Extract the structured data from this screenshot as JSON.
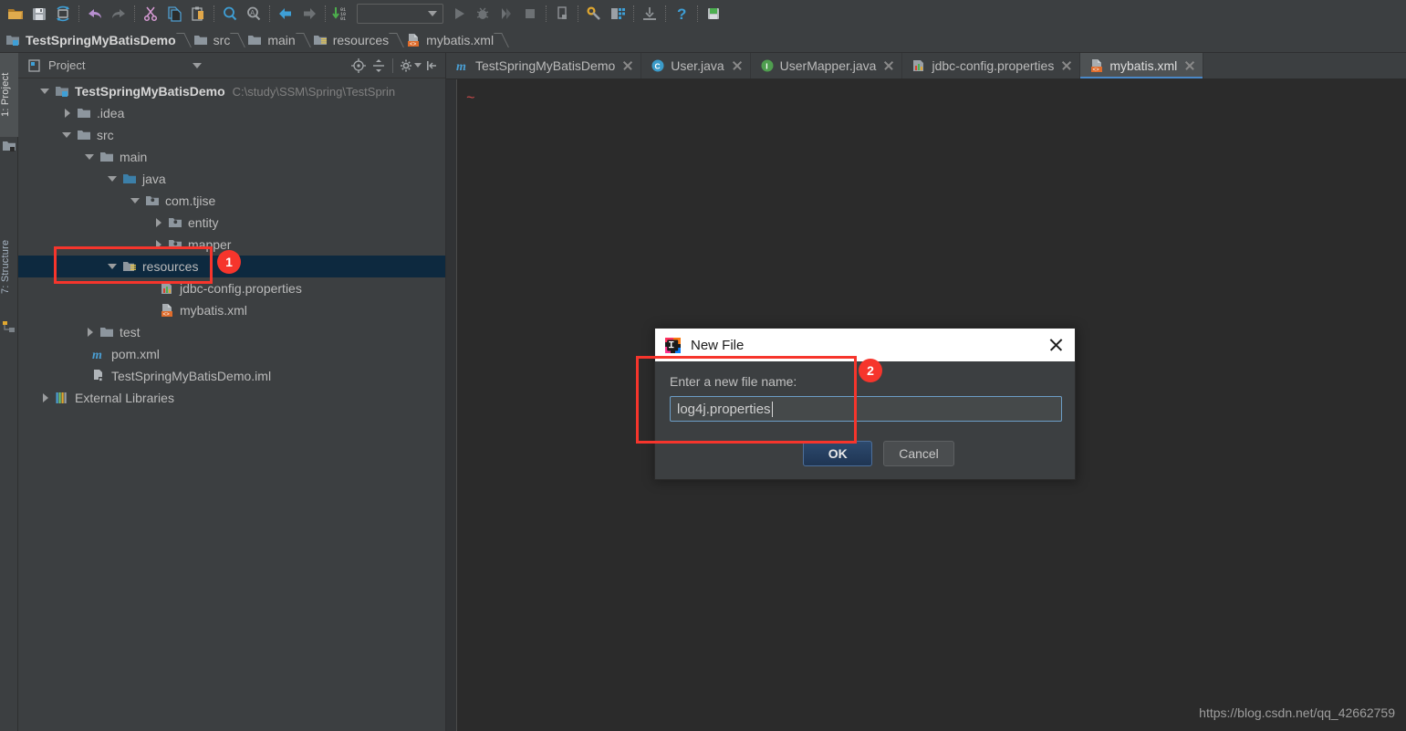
{
  "toolbar": {
    "items": [
      {
        "name": "open-folder-icon",
        "title": "Open"
      },
      {
        "name": "save-all-icon",
        "title": "Save All"
      },
      {
        "name": "sync-refresh-icon",
        "title": "Synchronize"
      },
      {
        "name": "undo-icon",
        "title": "Undo"
      },
      {
        "name": "redo-icon",
        "title": "Redo"
      },
      {
        "name": "cut-icon",
        "title": "Cut"
      },
      {
        "name": "copy-icon",
        "title": "Copy"
      },
      {
        "name": "paste-icon",
        "title": "Paste"
      },
      {
        "name": "find-icon",
        "title": "Find"
      },
      {
        "name": "replace-icon",
        "title": "Replace"
      },
      {
        "name": "back-navigate-icon",
        "title": "Back"
      },
      {
        "name": "forward-navigate-icon",
        "title": "Forward"
      },
      {
        "name": "compile-icon",
        "title": "Compile"
      }
    ],
    "run_config_value": "",
    "run_items": [
      {
        "name": "run-icon",
        "title": "Run"
      },
      {
        "name": "debug-icon",
        "title": "Debug"
      },
      {
        "name": "coverage-icon",
        "title": "Run with Coverage"
      },
      {
        "name": "stop-icon",
        "title": "Stop"
      },
      {
        "name": "update-app-icon",
        "title": "Update Application"
      },
      {
        "name": "settings-wrench-icon",
        "title": "Settings"
      },
      {
        "name": "project-structure-icon",
        "title": "Project Structure"
      },
      {
        "name": "update-project-icon",
        "title": "Update Project"
      },
      {
        "name": "help-icon",
        "title": "Help"
      },
      {
        "name": "database-icon",
        "title": "Database"
      }
    ]
  },
  "breadcrumb": {
    "items": [
      {
        "label": "TestSpringMyBatisDemo",
        "icon": "module-icon",
        "root": true
      },
      {
        "label": "src",
        "icon": "folder-icon",
        "root": false
      },
      {
        "label": "main",
        "icon": "folder-icon",
        "root": false
      },
      {
        "label": "resources",
        "icon": "resources-folder-icon",
        "root": false
      },
      {
        "label": "mybatis.xml",
        "icon": "xml-file-icon",
        "root": false
      }
    ]
  },
  "left_bar": {
    "tabs": [
      {
        "label": "1: Project",
        "selected": true,
        "icon": "project-tool-icon"
      },
      {
        "label": "7: Structure",
        "selected": false,
        "icon": "structure-tool-icon"
      }
    ]
  },
  "project_panel": {
    "title": "Project",
    "title_icon": "project-view-icon",
    "header_buttons": [
      {
        "name": "scroll-from-source-icon",
        "title": "Select Opened File"
      },
      {
        "name": "collapse-all-icon",
        "title": "Collapse All"
      },
      {
        "name": "settings-gear-icon",
        "title": "Show Options Menu"
      },
      {
        "name": "hide-panel-icon",
        "title": "Hide"
      }
    ],
    "tree": [
      {
        "label": "TestSpringMyBatisDemo",
        "path": "C:\\study\\SSM\\Spring\\TestSprin",
        "depth": 0,
        "state": "open",
        "icon": "module-icon",
        "bold": true,
        "selected": false
      },
      {
        "label": ".idea",
        "path": "",
        "depth": 1,
        "state": "closed",
        "icon": "folder-icon",
        "bold": false,
        "selected": false
      },
      {
        "label": "src",
        "path": "",
        "depth": 1,
        "state": "open",
        "icon": "folder-icon",
        "bold": false,
        "selected": false
      },
      {
        "label": "main",
        "path": "",
        "depth": 2,
        "state": "open",
        "icon": "folder-icon",
        "bold": false,
        "selected": false
      },
      {
        "label": "java",
        "path": "",
        "depth": 3,
        "state": "open",
        "icon": "source-folder-icon",
        "bold": false,
        "selected": false
      },
      {
        "label": "com.tjise",
        "path": "",
        "depth": 4,
        "state": "open",
        "icon": "package-icon",
        "bold": false,
        "selected": false
      },
      {
        "label": "entity",
        "path": "",
        "depth": 5,
        "state": "closed",
        "icon": "package-icon",
        "bold": false,
        "selected": false
      },
      {
        "label": "mapper",
        "path": "",
        "depth": 5,
        "state": "closed",
        "icon": "package-icon",
        "bold": false,
        "selected": false
      },
      {
        "label": "resources",
        "path": "",
        "depth": 3,
        "state": "open",
        "icon": "resources-folder-icon",
        "bold": false,
        "selected": true
      },
      {
        "label": "jdbc-config.properties",
        "path": "",
        "depth": 4,
        "state": "none",
        "icon": "properties-file-icon",
        "bold": false,
        "selected": false
      },
      {
        "label": "mybatis.xml",
        "path": "",
        "depth": 4,
        "state": "none",
        "icon": "xml-file-icon",
        "bold": false,
        "selected": false
      },
      {
        "label": "test",
        "path": "",
        "depth": 2,
        "state": "closed",
        "icon": "folder-icon",
        "bold": false,
        "selected": false
      },
      {
        "label": "pom.xml",
        "path": "",
        "depth": 2,
        "state": "none",
        "icon": "maven-icon",
        "bold": false,
        "selected": false
      },
      {
        "label": "TestSpringMyBatisDemo.iml",
        "path": "",
        "depth": 2,
        "state": "none",
        "icon": "iml-file-icon",
        "bold": false,
        "selected": false
      },
      {
        "label": "External Libraries",
        "path": "",
        "depth": 0,
        "state": "closed",
        "icon": "libraries-icon",
        "bold": false,
        "selected": false
      }
    ]
  },
  "editor": {
    "tabs": [
      {
        "label": "TestSpringMyBatisDemo",
        "icon": "maven-icon",
        "active": false
      },
      {
        "label": "User.java",
        "icon": "class-icon",
        "active": false
      },
      {
        "label": "UserMapper.java",
        "icon": "interface-icon",
        "active": false
      },
      {
        "label": "jdbc-config.properties",
        "icon": "properties-file-icon",
        "active": false
      },
      {
        "label": "mybatis.xml",
        "icon": "xml-file-icon",
        "active": true
      }
    ],
    "content_marker": "~"
  },
  "dialog": {
    "title": "New File",
    "title_icon": "intellij-logo-icon",
    "label": "Enter a new file name:",
    "input_value": "log4j.properties",
    "ok_label": "OK",
    "cancel_label": "Cancel"
  },
  "annotations": [
    {
      "badge": "1",
      "type": "tree-resources-highlight"
    },
    {
      "badge": "2",
      "type": "dialog-input-highlight"
    }
  ],
  "watermark": "https://blog.csdn.net/qq_42662759",
  "colors": {
    "panel_bg": "#3c3f41",
    "editor_bg": "#2b2b2b",
    "selection_bg": "#0d293f",
    "accent_blue": "#4a88c7",
    "annotation_red": "#f6352c",
    "text": "#bbbbbb"
  }
}
